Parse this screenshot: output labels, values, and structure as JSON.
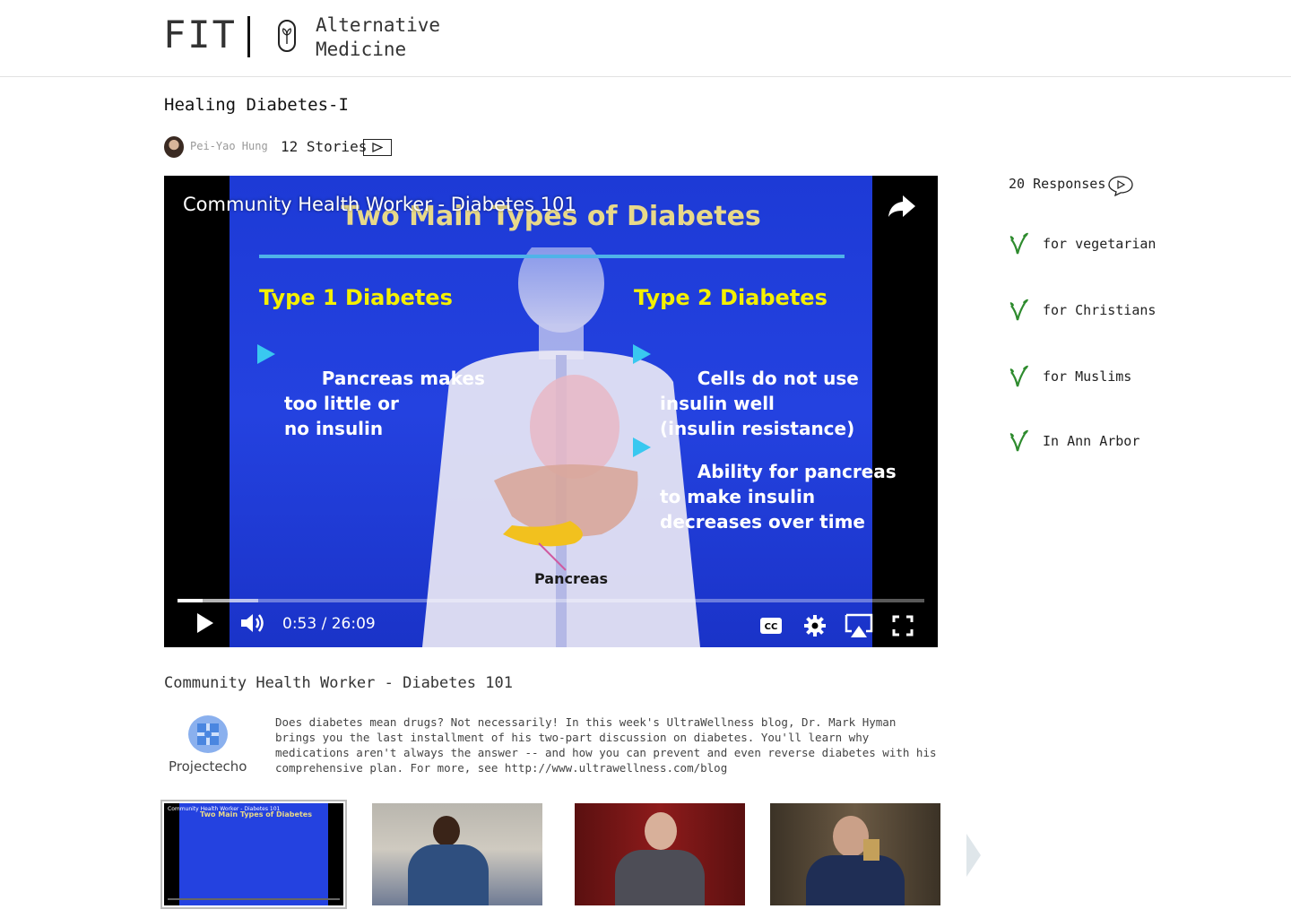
{
  "header": {
    "logo": "FIT",
    "section_line1": "Alternative",
    "section_line2": "Medicine",
    "icon": "seed-pill-icon"
  },
  "story": {
    "title": "Healing Diabetes-I",
    "author": "Pei-Yao Hung",
    "stories_label": "12 Stories"
  },
  "video": {
    "title": "Community Health Worker - Diabetes 101",
    "slide_heading": "Two Main Types of Diabetes",
    "type1_heading": "Type 1 Diabetes",
    "type1_bullets": [
      "Pancreas makes\ntoo little or\nno insulin"
    ],
    "type2_heading": "Type 2 Diabetes",
    "type2_bullets": [
      "Cells do not use\ninsulin well\n(insulin resistance)",
      "Ability for pancreas\nto make insulin\ndecreases over time"
    ],
    "pancreas_label": "Pancreas",
    "time": "0:53 / 26:09",
    "progress_played_fraction": 0.034,
    "progress_buffered_fraction": 0.108
  },
  "responses": {
    "label": "20 Responses",
    "items": [
      "for vegetarian",
      "for Christians",
      "for Muslims",
      "In Ann Arbor"
    ]
  },
  "details": {
    "caption": "Community Health Worker - Diabetes 101",
    "channel": "Projectecho",
    "description": "Does diabetes mean drugs? Not necessarily! In this week's UltraWellness blog, Dr. Mark Hyman brings you the last installment of his two-part discussion on diabetes. You'll learn why medications aren't always the answer -- and how you can prevent and even reverse diabetes with his comprehensive plan. For more, see http://www.ultrawellness.com/blog"
  },
  "thumbnails": {
    "mini_title": "Community Health Worker - Diabetes 101",
    "mini_heading": "Two Main Types of Diabetes"
  },
  "colors": {
    "accent_green": "#2e8b2e",
    "slide_blue": "#2442e0",
    "slide_yellow": "#f4f000",
    "bullet_cyan": "#39c8f0"
  }
}
